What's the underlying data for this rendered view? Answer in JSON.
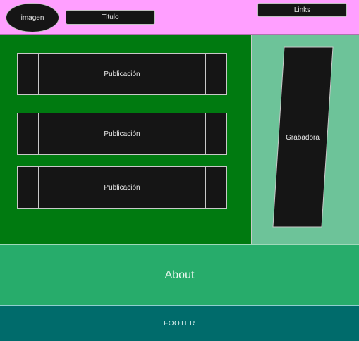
{
  "header": {
    "logo_label": "imagen",
    "title_label": "Titulo",
    "links_label": "Links"
  },
  "main": {
    "posts": [
      {
        "label": "Publicación"
      },
      {
        "label": "Publicación"
      },
      {
        "label": "Publicación"
      }
    ]
  },
  "aside": {
    "recorder_label": "Grabadora"
  },
  "about": {
    "label": "About"
  },
  "footer": {
    "label": "FOOTER"
  },
  "colors": {
    "header_bg": "#ff9fff",
    "main_bg": "#007a10",
    "aside_bg": "#6dc399",
    "about_bg": "#27ac6b",
    "footer_bg": "#006b6b",
    "box_bg": "#151515"
  }
}
